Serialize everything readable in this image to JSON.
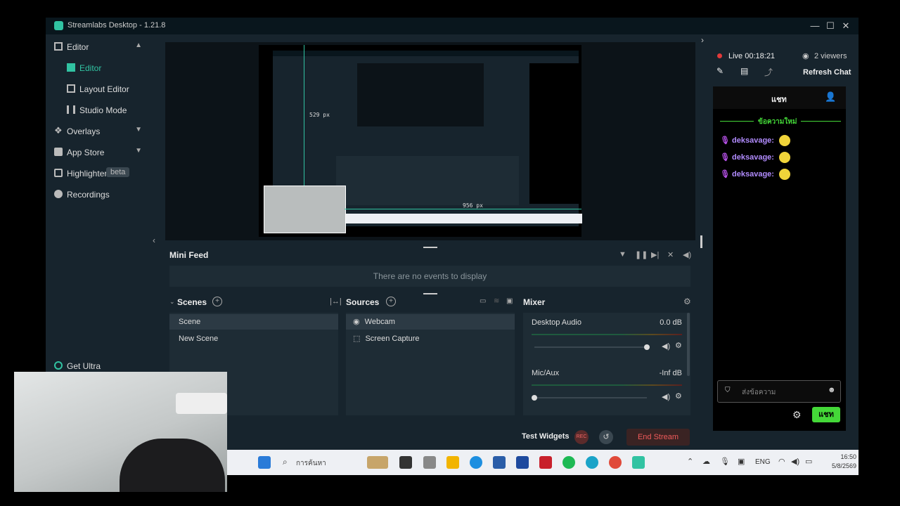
{
  "window": {
    "title": "Streamlabs Desktop - 1.21.8"
  },
  "sidebar": {
    "editor_section": "Editor",
    "items": [
      {
        "label": "Editor"
      },
      {
        "label": "Layout Editor"
      },
      {
        "label": "Studio Mode"
      }
    ],
    "overlays": "Overlays",
    "app_store": "App Store",
    "highlighter": "Highlighter",
    "highlighter_badge": "beta",
    "recordings": "Recordings",
    "get_ultra": "Get Ultra"
  },
  "preview": {
    "measure_vertical": "529 px",
    "measure_horizontal": "956 px"
  },
  "minifeed": {
    "title": "Mini Feed",
    "empty": "There are no events to display"
  },
  "scenes": {
    "title": "Scenes",
    "items": [
      "Scene",
      "New Scene"
    ]
  },
  "sources": {
    "title": "Sources",
    "items": [
      "Webcam",
      "Screen Capture"
    ]
  },
  "mixer": {
    "title": "Mixer",
    "channels": [
      {
        "name": "Desktop Audio",
        "db": "0.0 dB",
        "level": 1.0
      },
      {
        "name": "Mic/Aux",
        "db": "-Inf dB",
        "level": 0.0
      }
    ]
  },
  "footer": {
    "test_widgets": "Test Widgets",
    "rec": "REC",
    "end_stream": "End Stream"
  },
  "chat": {
    "live": "Live 00:18:21",
    "viewers": "2 viewers",
    "refresh": "Refresh Chat",
    "tab": "แชท",
    "new_messages": "ข้อความใหม่",
    "messages": [
      {
        "user": "deksavage:"
      },
      {
        "user": "deksavage:"
      },
      {
        "user": "deksavage:"
      }
    ],
    "input_placeholder": "ส่งข้อความ",
    "send": "แชท"
  },
  "taskbar": {
    "search_placeholder": "การค้นหา",
    "lang": "ENG",
    "time": "16:50",
    "date": "5/8/2569"
  },
  "colors": {
    "accent": "#31c3a2",
    "chat_green": "#44d838",
    "end_stream": "#f05a5a"
  }
}
